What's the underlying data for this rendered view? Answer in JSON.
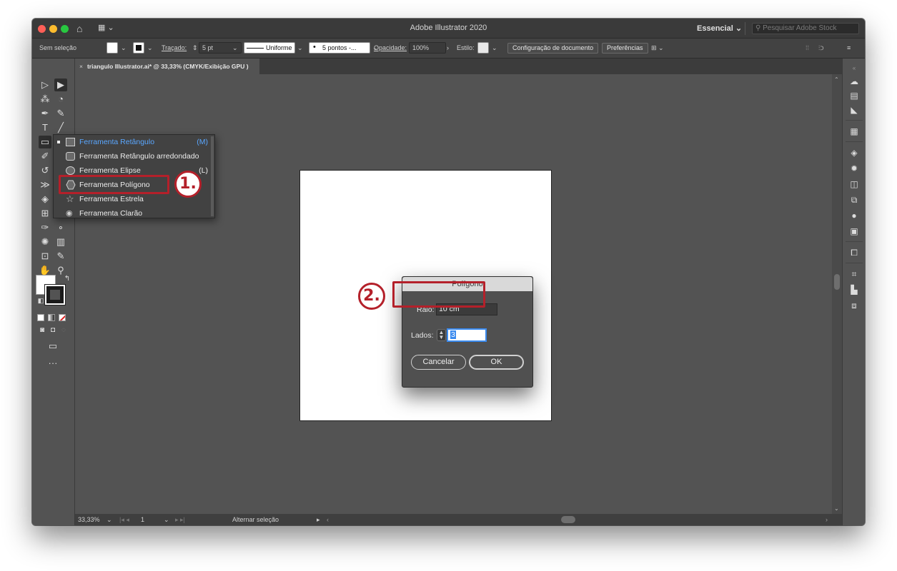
{
  "app": {
    "title": "Adobe Illustrator 2020",
    "workspace": "Essencial",
    "stock_search_placeholder": "Pesquisar Adobe Stock"
  },
  "controlbar": {
    "selection": "Sem seleção",
    "stroke_label": "Traçado:",
    "stroke_value": "5 pt",
    "profile": "Uniforme",
    "brush": "5 pontos -...",
    "opacity_label": "Opacidade:",
    "opacity_value": "100%",
    "style_label": "Estilo:",
    "doc_setup": "Configuração de documento",
    "prefs": "Preferências"
  },
  "tab": {
    "close": "×",
    "title": "triangulo Illustrator.ai* @ 33,33% (CMYK/Exibição GPU )"
  },
  "flyout": {
    "items": [
      {
        "label": "Ferramenta Retângulo",
        "key": "(M)"
      },
      {
        "label": "Ferramenta Retângulo arredondado",
        "key": ""
      },
      {
        "label": "Ferramenta Elipse",
        "key": "(L)"
      },
      {
        "label": "Ferramenta Polígono",
        "key": ""
      },
      {
        "label": "Ferramenta Estrela",
        "key": ""
      },
      {
        "label": "Ferramenta Clarão",
        "key": ""
      }
    ]
  },
  "annotations": {
    "step1": "1.",
    "step2": "2."
  },
  "dialog": {
    "title": "Polígono",
    "radius_label": "Raio:",
    "radius_value": "10 cm",
    "sides_label": "Lados:",
    "sides_value": "3",
    "cancel": "Cancelar",
    "ok": "OK"
  },
  "status": {
    "zoom": "33,33%",
    "page": "1",
    "toggle": "Alternar seleção"
  },
  "colors": {
    "highlight": "#b4202a",
    "flyout_current": "#5aa7ff",
    "focus": "#3b8bef"
  }
}
